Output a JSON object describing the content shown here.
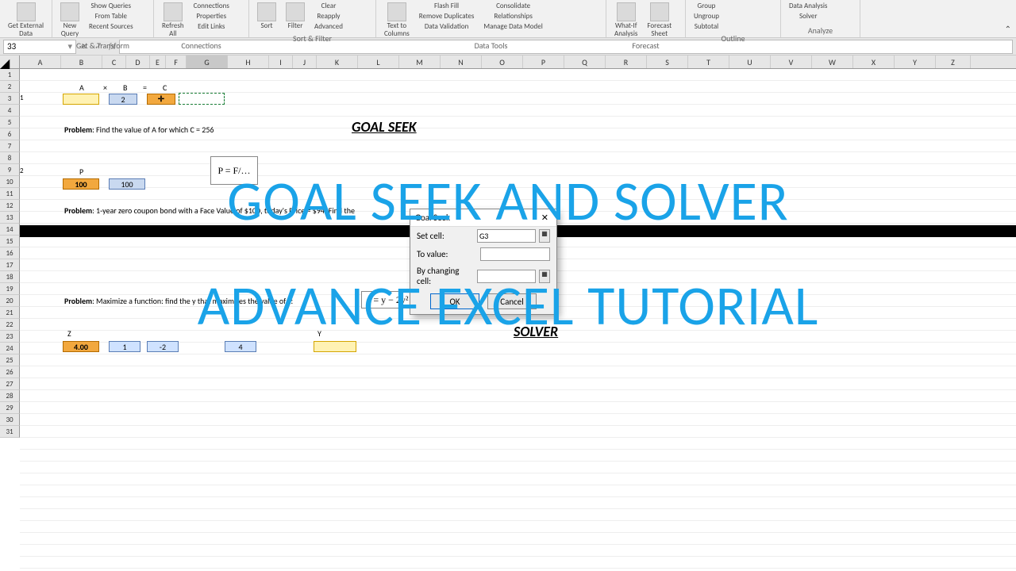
{
  "ribbon": {
    "groups": [
      {
        "label": "",
        "items": [
          {
            "txt": "Get External\nData"
          }
        ]
      },
      {
        "label": "Get & Transform",
        "items": [
          {
            "txt": "New\nQuery"
          },
          {
            "txt": "Show Queries"
          },
          {
            "txt": "From Table"
          },
          {
            "txt": "Recent Sources"
          }
        ]
      },
      {
        "label": "Connections",
        "items": [
          {
            "txt": "Refresh\nAll"
          },
          {
            "txt": "Connections"
          },
          {
            "txt": "Properties"
          },
          {
            "txt": "Edit Links"
          }
        ]
      },
      {
        "label": "Sort & Filter",
        "items": [
          {
            "txt": "Sort"
          },
          {
            "txt": "Filter"
          },
          {
            "txt": "Clear"
          },
          {
            "txt": "Reapply"
          },
          {
            "txt": "Advanced"
          }
        ]
      },
      {
        "label": "Data Tools",
        "items": [
          {
            "txt": "Text to\nColumns"
          },
          {
            "txt": "Flash Fill"
          },
          {
            "txt": "Remove Duplicates"
          },
          {
            "txt": "Data Validation"
          },
          {
            "txt": "Consolidate"
          },
          {
            "txt": "Relationships"
          },
          {
            "txt": "Manage Data Model"
          }
        ]
      },
      {
        "label": "Forecast",
        "items": [
          {
            "txt": "What-If\nAnalysis"
          },
          {
            "txt": "Forecast\nSheet"
          }
        ]
      },
      {
        "label": "Outline",
        "items": [
          {
            "txt": "Group"
          },
          {
            "txt": "Ungroup"
          },
          {
            "txt": "Subtotal"
          }
        ]
      },
      {
        "label": "Analyze",
        "items": [
          {
            "txt": "Data Analysis"
          },
          {
            "txt": "Solver"
          }
        ]
      }
    ]
  },
  "namebox": "33",
  "columns": [
    "A",
    "B",
    "C",
    "D",
    "E",
    "F",
    "G",
    "H",
    "I",
    "J",
    "K",
    "L",
    "M",
    "N",
    "O",
    "P",
    "Q",
    "R",
    "S",
    "T",
    "U",
    "V",
    "W",
    "X",
    "Y",
    "Z"
  ],
  "rows": 31,
  "eq_labels": {
    "A": "A",
    "times": "×",
    "B": "B",
    "eq": "=",
    "C": "C"
  },
  "boxes1": {
    "b_val": "2"
  },
  "problem1": {
    "bold": "Problem",
    "text": ": Find the value of A for which C = 256"
  },
  "title1": "GOAL SEEK",
  "row8": {
    "P": "P",
    "val1": "100",
    "val2": "100"
  },
  "problem2": {
    "bold": "Problem",
    "text": ": 1-year zero coupon bond with a Face Value of $100, today's Price = $94. Find the"
  },
  "problem3": {
    "bold": "Problem",
    "text": ": Maximize a function: find the y that maximizes the value of z:"
  },
  "formula": "z = y − 2y² + 4",
  "row19": {
    "Z": "Z",
    "Y": "Y"
  },
  "row20": {
    "z": "4.00",
    "a": "1",
    "b": "-2",
    "c": "4"
  },
  "title2": "SOLVER",
  "dialog": {
    "title": "Goal Seek",
    "set_cell_label": "Set cell:",
    "set_cell_value": "G3",
    "to_value_label": "To value:",
    "to_value_value": "",
    "by_changing_label": "By changing cell:",
    "by_changing_value": "",
    "ok": "OK",
    "cancel": "Cancel"
  },
  "overlay": {
    "line1": "GOAL SEEK AND SOLVER",
    "line2": "ADVANCE EXCEL TUTORIAL"
  }
}
